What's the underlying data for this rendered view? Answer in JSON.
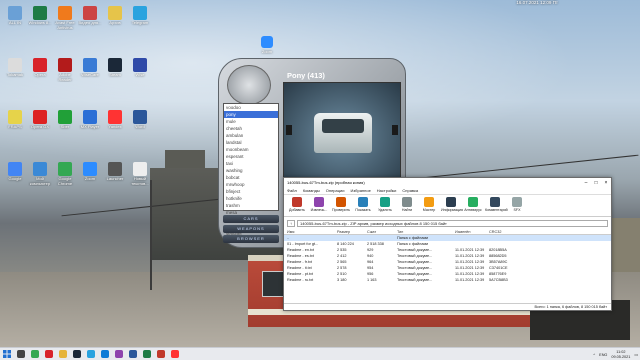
{
  "desktop": {
    "topbar_text": "16.07.2021 12:09 Пт",
    "icons": [
      {
        "label": "ALL IN",
        "color": "#6aa0d6"
      },
      {
        "label": "Windows 8...",
        "color": "#1e7b45"
      },
      {
        "label": "Avast Free Antivirus",
        "color": "#f07a1c"
      },
      {
        "label": "Видео для...",
        "color": "#cc4444"
      },
      {
        "label": "Архив",
        "color": "#e6c44a"
      },
      {
        "label": "Telegram",
        "color": "#2aa3df"
      },
      {
        "label": "Tokamak",
        "color": "#dcdcdc"
      },
      {
        "label": "Opera",
        "color": "#d8232a"
      },
      {
        "label": "Adobe Reader",
        "color": "#b31b1b"
      },
      {
        "label": "WiseCare",
        "color": "#3a7bd5"
      },
      {
        "label": "Steam",
        "color": "#1b2838"
      },
      {
        "label": "Wise",
        "color": "#2f4aa8"
      },
      {
        "label": "FRAPS",
        "color": "#e6d34a"
      },
      {
        "label": "Opera GX",
        "color": "#d22"
      },
      {
        "label": "Sber",
        "color": "#21a038"
      },
      {
        "label": "MX Player",
        "color": "#2b6fd6"
      },
      {
        "label": "Yandex",
        "color": "#f33"
      },
      {
        "label": "Word",
        "color": "#2b579a"
      },
      {
        "label": "Google",
        "color": "#4285f4"
      },
      {
        "label": "Мой компьютер",
        "color": "#3b89d6"
      },
      {
        "label": "Google Chrome",
        "color": "#34a853"
      },
      {
        "label": "Zoom",
        "color": "#2d8cff"
      },
      {
        "label": "Launcher",
        "color": "#555"
      },
      {
        "label": "Новый текстов...",
        "color": "#eee"
      }
    ],
    "zoom_label": "Zoom"
  },
  "mod_manager": {
    "title": "Pony (413)",
    "logo_text": "mod manager",
    "list_items": [
      "voodoo",
      "pony",
      "mule",
      "cheetah",
      "ambulan",
      "landstal",
      "moonbeam",
      "esperant",
      "taxi",
      "washing",
      "bobcat",
      "mrwhoop",
      "bfinject",
      "hotknife",
      "trashm",
      "mesa",
      "kart",
      "camper",
      "sentinel",
      "stretch"
    ],
    "selected_index": 1,
    "buttons": [
      "CARS",
      "WEAPONS",
      "BROWSER"
    ]
  },
  "winrar": {
    "title": "140055-bus-67Tm-bus.zip (пробная копия)",
    "menu": [
      "Файл",
      "Команды",
      "Операции",
      "Избранное",
      "Настройки",
      "Справка"
    ],
    "toolbar": [
      {
        "label": "Добавить",
        "color": "#c0392b"
      },
      {
        "label": "Извлечь...",
        "color": "#8e44ad"
      },
      {
        "label": "Проверить",
        "color": "#d35400"
      },
      {
        "label": "Показать",
        "color": "#2980b9"
      },
      {
        "label": "Удалить",
        "color": "#16a085"
      },
      {
        "label": "Найти",
        "color": "#7f8c8d"
      },
      {
        "label": "Мастер",
        "color": "#f39c12"
      },
      {
        "label": "Информация",
        "color": "#2c3e50"
      },
      {
        "label": "Антивирус",
        "color": "#27ae60"
      },
      {
        "label": "Комментарий",
        "color": "#34495e"
      },
      {
        "label": "SFX",
        "color": "#95a5a6"
      }
    ],
    "path": "140055-bus-67Tm-bus.zip - ZIP архив, размер исходных файлов 8 150 015 байт",
    "columns": [
      "Имя",
      "Размер",
      "Сжат",
      "Тип",
      "Изменён",
      "CRC32"
    ],
    "rows": [
      {
        "name": "..",
        "size": "",
        "packed": "",
        "type": "Папка с файлами",
        "modified": "",
        "crc": ""
      },
      {
        "name": "01 - Import for gt...",
        "size": "8 140 224",
        "packed": "2 518 338",
        "type": "Папка с файлами",
        "modified": "",
        "crc": ""
      },
      {
        "name": "Readme - en.txt",
        "size": "2 535",
        "packed": "929",
        "type": "Текстовый докуме...",
        "modified": "11.01.2021 12:39",
        "crc": "82018B5A"
      },
      {
        "name": "Readme - es.txt",
        "size": "2 412",
        "packed": "940",
        "type": "Текстовый докуме...",
        "modified": "11.01.2021 12:39",
        "crc": "885682D5"
      },
      {
        "name": "Readme - fr.txt",
        "size": "2 565",
        "packed": "964",
        "type": "Текстовый докуме...",
        "modified": "11.01.2021 12:39",
        "crc": "3B57A89C"
      },
      {
        "name": "Readme - it.txt",
        "size": "2 578",
        "packed": "954",
        "type": "Текстовый докуме...",
        "modified": "11.01.2021 12:39",
        "crc": "C37401CE"
      },
      {
        "name": "Readme - pt.txt",
        "size": "2 510",
        "packed": "956",
        "type": "Текстовый докуме...",
        "modified": "11.01.2021 12:39",
        "crc": "858776E9"
      },
      {
        "name": "Readme - ru.txt",
        "size": "3 180",
        "packed": "1 163",
        "type": "Текстовый докуме...",
        "modified": "11.01.2021 12:39",
        "crc": "5A7CB8B3"
      }
    ],
    "status_left": "",
    "status_right": "Всего: 1 папка, 6 файлов, 8 150 015 байт"
  },
  "taskbar": {
    "apps": [
      {
        "name": "search",
        "color": "#444"
      },
      {
        "name": "chrome",
        "color": "#34a853"
      },
      {
        "name": "opera",
        "color": "#d8232a"
      },
      {
        "name": "explorer",
        "color": "#e6b43a"
      },
      {
        "name": "steam",
        "color": "#1b2838"
      },
      {
        "name": "telegram",
        "color": "#2aa3df"
      },
      {
        "name": "edge",
        "color": "#0f7bd6"
      },
      {
        "name": "winrar",
        "color": "#8e44ad"
      },
      {
        "name": "word",
        "color": "#2b579a"
      },
      {
        "name": "excel",
        "color": "#1e7b45"
      },
      {
        "name": "game",
        "color": "#c0392b"
      },
      {
        "name": "yandex",
        "color": "#f33"
      }
    ],
    "lang": "ENG",
    "time": "11:02",
    "date": "09.05.2021"
  }
}
